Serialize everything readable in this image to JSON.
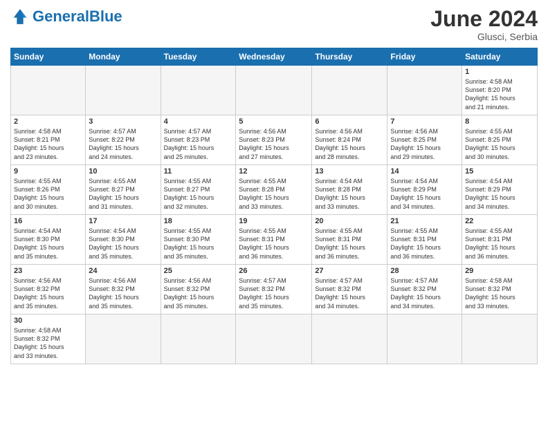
{
  "header": {
    "logo_general": "General",
    "logo_blue": "Blue",
    "title": "June 2024",
    "location": "Glusci, Serbia"
  },
  "weekdays": [
    "Sunday",
    "Monday",
    "Tuesday",
    "Wednesday",
    "Thursday",
    "Friday",
    "Saturday"
  ],
  "weeks": [
    [
      {
        "day": "",
        "info": ""
      },
      {
        "day": "",
        "info": ""
      },
      {
        "day": "",
        "info": ""
      },
      {
        "day": "",
        "info": ""
      },
      {
        "day": "",
        "info": ""
      },
      {
        "day": "",
        "info": ""
      },
      {
        "day": "1",
        "info": "Sunrise: 4:58 AM\nSunset: 8:20 PM\nDaylight: 15 hours\nand 21 minutes."
      }
    ],
    [
      {
        "day": "2",
        "info": "Sunrise: 4:58 AM\nSunset: 8:21 PM\nDaylight: 15 hours\nand 23 minutes."
      },
      {
        "day": "3",
        "info": "Sunrise: 4:57 AM\nSunset: 8:22 PM\nDaylight: 15 hours\nand 24 minutes."
      },
      {
        "day": "4",
        "info": "Sunrise: 4:57 AM\nSunset: 8:23 PM\nDaylight: 15 hours\nand 25 minutes."
      },
      {
        "day": "5",
        "info": "Sunrise: 4:56 AM\nSunset: 8:23 PM\nDaylight: 15 hours\nand 27 minutes."
      },
      {
        "day": "6",
        "info": "Sunrise: 4:56 AM\nSunset: 8:24 PM\nDaylight: 15 hours\nand 28 minutes."
      },
      {
        "day": "7",
        "info": "Sunrise: 4:56 AM\nSunset: 8:25 PM\nDaylight: 15 hours\nand 29 minutes."
      },
      {
        "day": "8",
        "info": "Sunrise: 4:55 AM\nSunset: 8:25 PM\nDaylight: 15 hours\nand 30 minutes."
      }
    ],
    [
      {
        "day": "9",
        "info": "Sunrise: 4:55 AM\nSunset: 8:26 PM\nDaylight: 15 hours\nand 30 minutes."
      },
      {
        "day": "10",
        "info": "Sunrise: 4:55 AM\nSunset: 8:27 PM\nDaylight: 15 hours\nand 31 minutes."
      },
      {
        "day": "11",
        "info": "Sunrise: 4:55 AM\nSunset: 8:27 PM\nDaylight: 15 hours\nand 32 minutes."
      },
      {
        "day": "12",
        "info": "Sunrise: 4:55 AM\nSunset: 8:28 PM\nDaylight: 15 hours\nand 33 minutes."
      },
      {
        "day": "13",
        "info": "Sunrise: 4:54 AM\nSunset: 8:28 PM\nDaylight: 15 hours\nand 33 minutes."
      },
      {
        "day": "14",
        "info": "Sunrise: 4:54 AM\nSunset: 8:29 PM\nDaylight: 15 hours\nand 34 minutes."
      },
      {
        "day": "15",
        "info": "Sunrise: 4:54 AM\nSunset: 8:29 PM\nDaylight: 15 hours\nand 34 minutes."
      }
    ],
    [
      {
        "day": "16",
        "info": "Sunrise: 4:54 AM\nSunset: 8:30 PM\nDaylight: 15 hours\nand 35 minutes."
      },
      {
        "day": "17",
        "info": "Sunrise: 4:54 AM\nSunset: 8:30 PM\nDaylight: 15 hours\nand 35 minutes."
      },
      {
        "day": "18",
        "info": "Sunrise: 4:55 AM\nSunset: 8:30 PM\nDaylight: 15 hours\nand 35 minutes."
      },
      {
        "day": "19",
        "info": "Sunrise: 4:55 AM\nSunset: 8:31 PM\nDaylight: 15 hours\nand 36 minutes."
      },
      {
        "day": "20",
        "info": "Sunrise: 4:55 AM\nSunset: 8:31 PM\nDaylight: 15 hours\nand 36 minutes."
      },
      {
        "day": "21",
        "info": "Sunrise: 4:55 AM\nSunset: 8:31 PM\nDaylight: 15 hours\nand 36 minutes."
      },
      {
        "day": "22",
        "info": "Sunrise: 4:55 AM\nSunset: 8:31 PM\nDaylight: 15 hours\nand 36 minutes."
      }
    ],
    [
      {
        "day": "23",
        "info": "Sunrise: 4:56 AM\nSunset: 8:32 PM\nDaylight: 15 hours\nand 35 minutes."
      },
      {
        "day": "24",
        "info": "Sunrise: 4:56 AM\nSunset: 8:32 PM\nDaylight: 15 hours\nand 35 minutes."
      },
      {
        "day": "25",
        "info": "Sunrise: 4:56 AM\nSunset: 8:32 PM\nDaylight: 15 hours\nand 35 minutes."
      },
      {
        "day": "26",
        "info": "Sunrise: 4:57 AM\nSunset: 8:32 PM\nDaylight: 15 hours\nand 35 minutes."
      },
      {
        "day": "27",
        "info": "Sunrise: 4:57 AM\nSunset: 8:32 PM\nDaylight: 15 hours\nand 34 minutes."
      },
      {
        "day": "28",
        "info": "Sunrise: 4:57 AM\nSunset: 8:32 PM\nDaylight: 15 hours\nand 34 minutes."
      },
      {
        "day": "29",
        "info": "Sunrise: 4:58 AM\nSunset: 8:32 PM\nDaylight: 15 hours\nand 33 minutes."
      }
    ],
    [
      {
        "day": "30",
        "info": "Sunrise: 4:58 AM\nSunset: 8:32 PM\nDaylight: 15 hours\nand 33 minutes."
      },
      {
        "day": "",
        "info": ""
      },
      {
        "day": "",
        "info": ""
      },
      {
        "day": "",
        "info": ""
      },
      {
        "day": "",
        "info": ""
      },
      {
        "day": "",
        "info": ""
      },
      {
        "day": "",
        "info": ""
      }
    ]
  ]
}
